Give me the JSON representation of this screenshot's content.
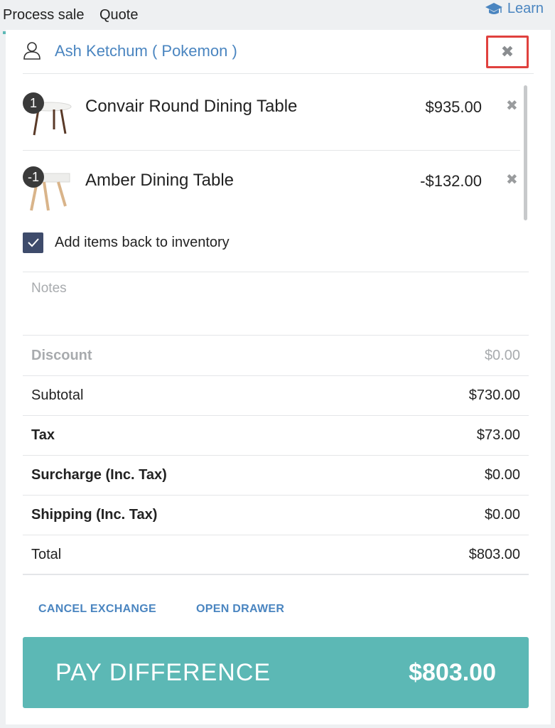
{
  "tabs": {
    "process_sale": "Process sale",
    "quote": "Quote",
    "learn": "Learn"
  },
  "customer": {
    "name": "Ash Ketchum ( Pokemon )",
    "close_icon": "✖"
  },
  "line_items": [
    {
      "qty": "1",
      "name": "Convair Round Dining Table",
      "price": "$935.00",
      "remove_icon": "✖"
    },
    {
      "qty": "-1",
      "name": "Amber Dining Table",
      "price": "-$132.00",
      "remove_icon": "✖"
    }
  ],
  "inventory": {
    "label": "Add items back to inventory",
    "checked": true
  },
  "notes": {
    "placeholder": "Notes",
    "value": ""
  },
  "totals": {
    "discount_label": "Discount",
    "discount_value": "$0.00",
    "subtotal_label": "Subtotal",
    "subtotal_value": "$730.00",
    "tax_label": "Tax",
    "tax_value": "$73.00",
    "surcharge_label": "Surcharge (Inc. Tax)",
    "surcharge_value": "$0.00",
    "shipping_label": "Shipping (Inc. Tax)",
    "shipping_value": "$0.00",
    "total_label": "Total",
    "total_value": "$803.00"
  },
  "actions": {
    "cancel_exchange": "CANCEL EXCHANGE",
    "open_drawer": "OPEN DRAWER"
  },
  "pay": {
    "label": "PAY DIFFERENCE",
    "amount": "$803.00"
  },
  "colors": {
    "accent": "#5cb8b5",
    "link": "#4a85c0",
    "highlight": "#e0413e",
    "checkbox": "#3e4b6b"
  },
  "icons": {
    "learn": "graduation-cap-icon",
    "customer": "user-icon",
    "close": "close-icon",
    "checkbox": "check-icon"
  }
}
